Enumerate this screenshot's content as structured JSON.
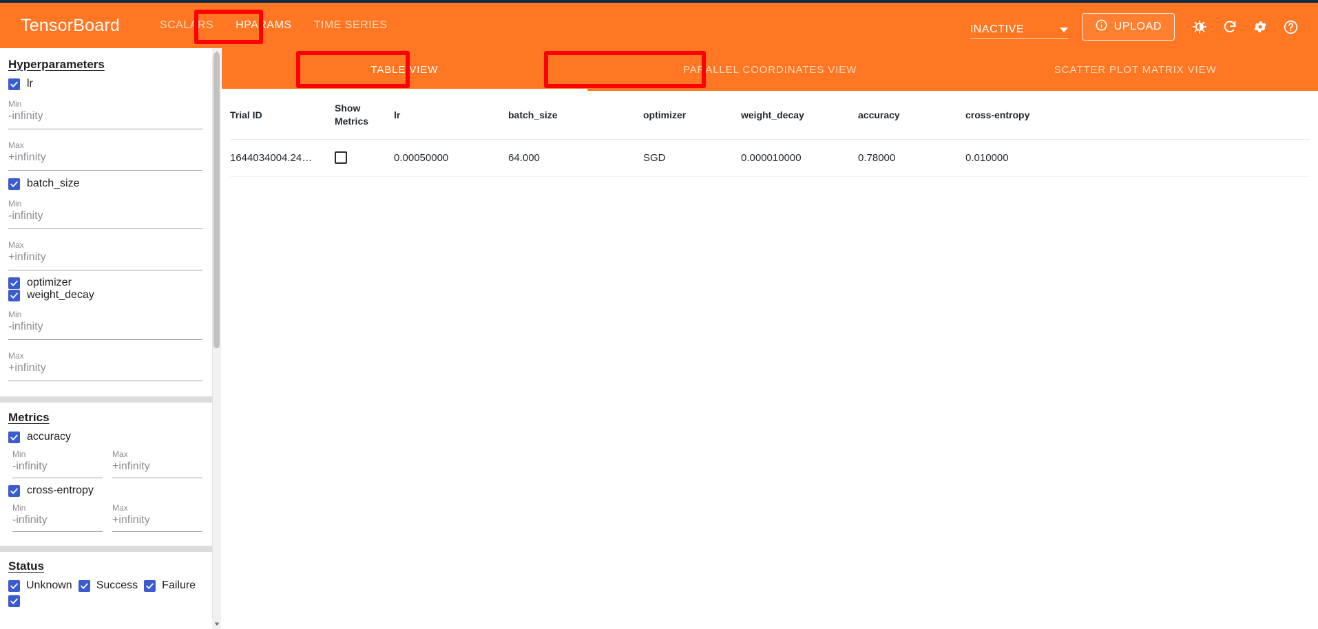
{
  "header": {
    "brand": "TensorBoard",
    "nav": [
      {
        "label": "SCALARS",
        "active": false
      },
      {
        "label": "HPARAMS",
        "active": true
      },
      {
        "label": "TIME SERIES",
        "active": false
      }
    ],
    "run_selector_value": "INACTIVE",
    "upload_label": "UPLOAD",
    "icons": [
      "info-icon",
      "brightness-icon",
      "refresh-icon",
      "gear-icon",
      "help-icon"
    ],
    "accent_color": "#ff7722",
    "annotation_color": "#fd0000"
  },
  "sidebar": {
    "hyperparameters": {
      "title": "Hyperparameters",
      "items": [
        {
          "name": "lr",
          "checked": true,
          "min_label": "Min",
          "min_value": "-infinity",
          "max_label": "Max",
          "max_value": "+infinity"
        },
        {
          "name": "batch_size",
          "checked": true,
          "min_label": "Min",
          "min_value": "-infinity",
          "max_label": "Max",
          "max_value": "+infinity"
        },
        {
          "name": "optimizer",
          "checked": true
        },
        {
          "name": "weight_decay",
          "checked": true,
          "min_label": "Min",
          "min_value": "-infinity",
          "max_label": "Max",
          "max_value": "+infinity"
        }
      ]
    },
    "metrics": {
      "title": "Metrics",
      "items": [
        {
          "name": "accuracy",
          "checked": true,
          "min_label": "Min",
          "min_value": "-infinity",
          "max_label": "Max",
          "max_value": "+infinity"
        },
        {
          "name": "cross-entropy",
          "checked": true,
          "min_label": "Min",
          "min_value": "-infinity",
          "max_label": "Max",
          "max_value": "+infinity"
        }
      ]
    },
    "status": {
      "title": "Status",
      "items": [
        {
          "name": "Unknown",
          "checked": true
        },
        {
          "name": "Success",
          "checked": true
        },
        {
          "name": "Failure",
          "checked": true
        }
      ]
    }
  },
  "main": {
    "view_tabs": [
      {
        "label": "TABLE VIEW",
        "active": true,
        "annotated": true
      },
      {
        "label": "PARALLEL COORDINATES VIEW",
        "active": false,
        "annotated": true
      },
      {
        "label": "SCATTER PLOT MATRIX VIEW",
        "active": false,
        "annotated": false
      }
    ],
    "table": {
      "columns": [
        "Trial ID",
        "Show Metrics",
        "lr",
        "batch_size",
        "optimizer",
        "weight_decay",
        "accuracy",
        "cross-entropy"
      ],
      "rows": [
        {
          "trial_id": "1644034004.24…",
          "show_metrics": false,
          "lr": "0.00050000",
          "batch_size": "64.000",
          "optimizer": "SGD",
          "weight_decay": "0.000010000",
          "accuracy": "0.78000",
          "cross_entropy": "0.010000"
        }
      ]
    }
  }
}
